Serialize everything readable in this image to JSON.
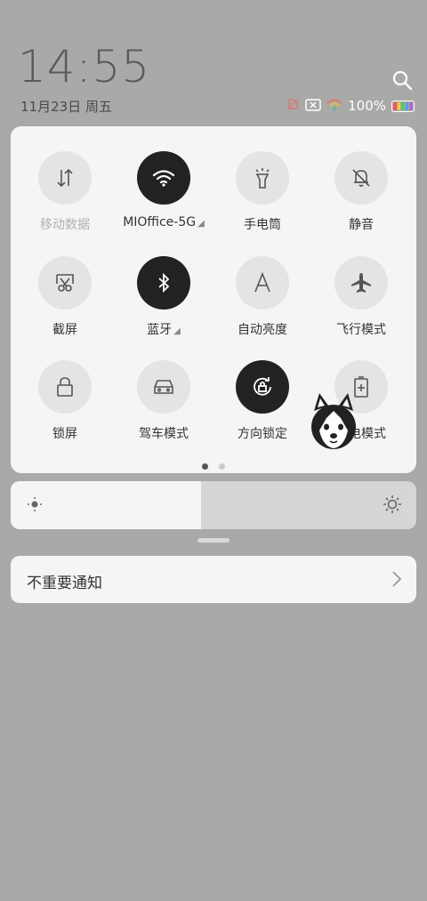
{
  "status": {
    "time": "14:55",
    "date": "11月23日 周五",
    "battery_percent": "100%"
  },
  "toggles": [
    {
      "id": "mobile-data",
      "label": "移动数据",
      "state": "disabled",
      "icon": "arrows-up-down-icon"
    },
    {
      "id": "wifi",
      "label": "MIOffice-5G",
      "state": "on",
      "icon": "wifi-icon",
      "has_arrow": true
    },
    {
      "id": "flashlight",
      "label": "手电筒",
      "state": "off",
      "icon": "flashlight-icon"
    },
    {
      "id": "silent",
      "label": "静音",
      "state": "off",
      "icon": "bell-off-icon"
    },
    {
      "id": "screenshot",
      "label": "截屏",
      "state": "off",
      "icon": "scissors-icon"
    },
    {
      "id": "bluetooth",
      "label": "蓝牙",
      "state": "on",
      "icon": "bluetooth-icon",
      "has_arrow": true
    },
    {
      "id": "auto-brightness",
      "label": "自动亮度",
      "state": "off",
      "icon": "letter-a-icon"
    },
    {
      "id": "airplane",
      "label": "飞行模式",
      "state": "off",
      "icon": "airplane-icon"
    },
    {
      "id": "lock-screen",
      "label": "锁屏",
      "state": "off",
      "icon": "lock-icon"
    },
    {
      "id": "driving-mode",
      "label": "驾车模式",
      "state": "off",
      "icon": "car-icon"
    },
    {
      "id": "rotation-lock",
      "label": "方向锁定",
      "state": "on",
      "icon": "rotation-lock-icon"
    },
    {
      "id": "battery-saver",
      "label": "省电模式",
      "state": "off",
      "icon": "battery-icon"
    }
  ],
  "pager": {
    "pages": 2,
    "active": 0
  },
  "brightness": {
    "level": 0.47
  },
  "notification": {
    "label": "不重要通知"
  },
  "colors": {
    "panel": "#f5f5f3",
    "on": "#222222",
    "off": "#e4e4e2",
    "background": "#a9a9a7"
  }
}
